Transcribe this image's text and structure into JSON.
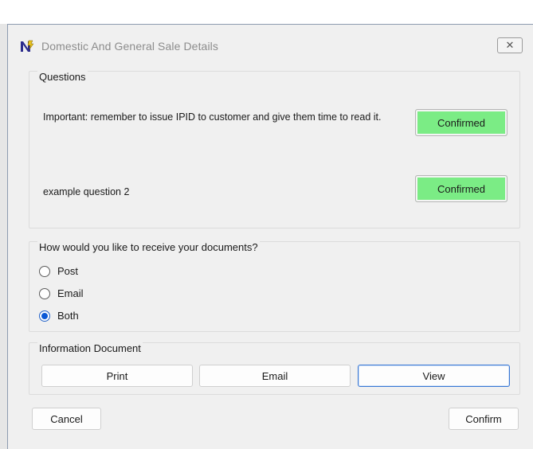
{
  "window": {
    "title": "Domestic And General Sale Details",
    "close_label": "✕"
  },
  "questions": {
    "label": "Questions",
    "items": [
      {
        "text": "Important: remember to issue IPID to customer and give them time to read it.",
        "status": "Confirmed"
      },
      {
        "text": "example question 2",
        "status": "Confirmed"
      }
    ]
  },
  "delivery": {
    "label": "How would you like to receive your documents?",
    "options": [
      {
        "label": "Post",
        "selected": false
      },
      {
        "label": "Email",
        "selected": false
      },
      {
        "label": "Both",
        "selected": true
      }
    ]
  },
  "info_document": {
    "label": "Information Document",
    "print_label": "Print",
    "email_label": "Email",
    "view_label": "View"
  },
  "footer": {
    "cancel_label": "Cancel",
    "confirm_label": "Confirm"
  },
  "colors": {
    "confirmed_bg": "#7bec85",
    "radio_selected": "#0a58d6",
    "focus_border": "#3a78d4"
  }
}
